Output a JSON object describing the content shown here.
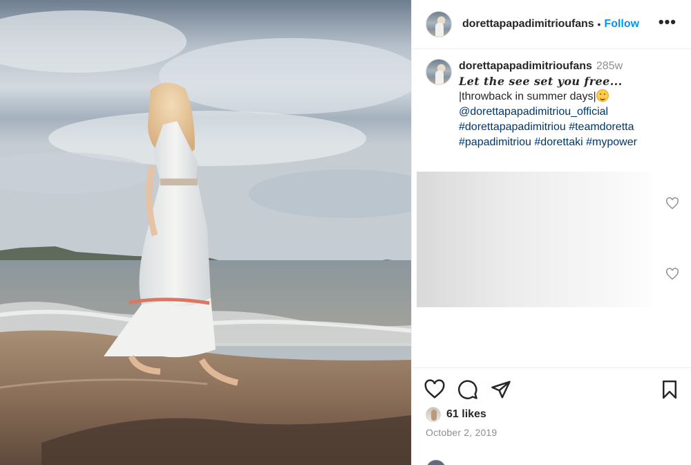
{
  "post": {
    "username": "dorettapapadimitrioufans",
    "separator": "•",
    "follow_label": "Follow",
    "more_label": "•••"
  },
  "caption": {
    "username": "dorettapapadimitrioufans",
    "time_ago": "285w",
    "line_1": "Let the see set you free...",
    "line_2": "|throwback in summer days|",
    "mention": "@dorettapapadimitriou_official",
    "hashtags_1": "#dorettapapadimitriou #teamdoretta",
    "hashtags_2": "#papadimitriou #dorettaki #mypower"
  },
  "icons": {
    "like": "heart-icon",
    "comment": "comment-icon",
    "share": "paper-plane-icon",
    "save": "bookmark-icon",
    "more": "more-options-icon",
    "comment_like": "heart-outline-icon"
  },
  "engagement": {
    "likes_text": "61 likes",
    "date_text": "October 2, 2019"
  },
  "colors": {
    "follow_blue": "#0095f6",
    "link_blue": "#00376b",
    "muted_gray": "#8e8e8e",
    "text_dark": "#262626"
  }
}
